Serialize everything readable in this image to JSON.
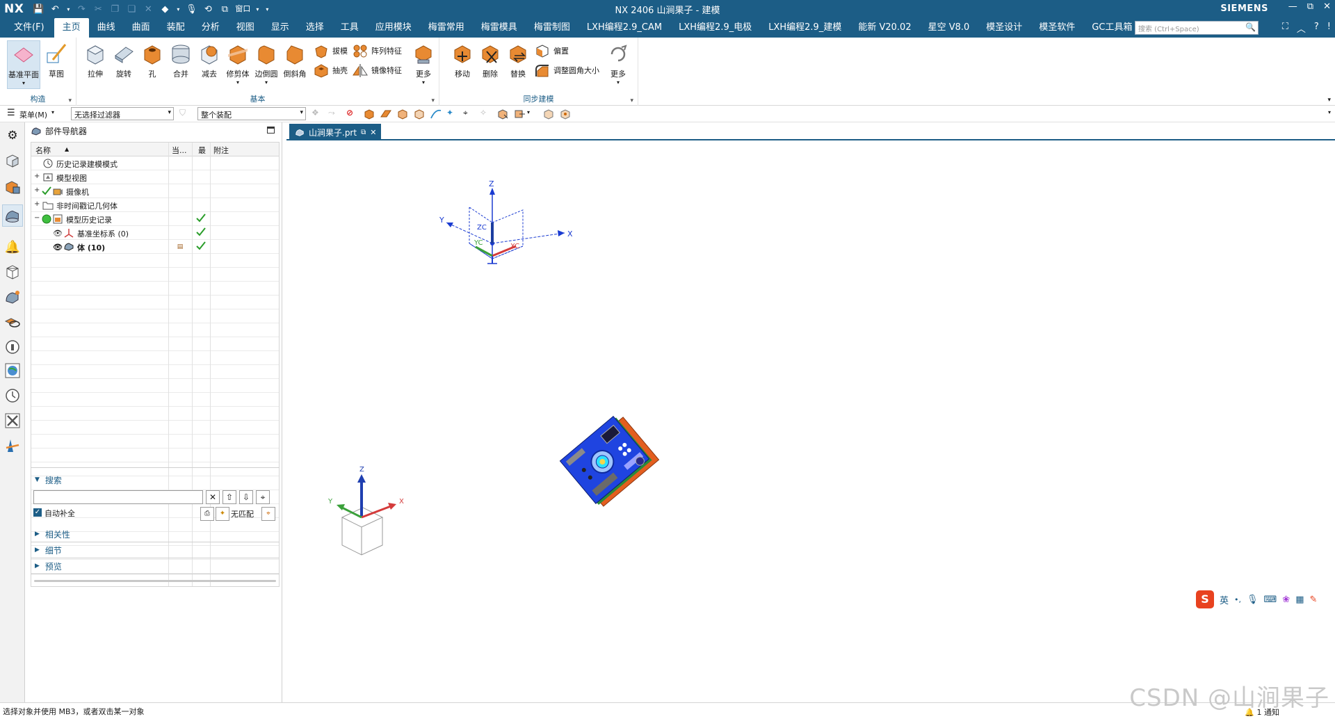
{
  "titlebar": {
    "logo": "NX",
    "title": "NX 2406 山涧果子 - 建模",
    "brand": "SIEMENS",
    "window_menu": "窗口",
    "win_min": "—",
    "win_restore": "⧉",
    "win_close": "✕"
  },
  "menubar": {
    "file": "文件(F)",
    "items": [
      "主页",
      "曲线",
      "曲面",
      "装配",
      "分析",
      "视图",
      "显示",
      "选择",
      "工具",
      "应用模块",
      "梅雷常用",
      "梅雷模具",
      "梅雷制图",
      "LXH编程2.9_CAM",
      "LXH编程2.9_电极",
      "LXH编程2.9_建模",
      "能新 V20.02",
      "星空 V8.0",
      "模圣设计",
      "模圣软件",
      "GC工具箱"
    ],
    "active": "主页",
    "search_placeholder": "搜索 (Ctrl+Space)"
  },
  "ribbon": {
    "groups": {
      "construct": "构造",
      "basic": "基本",
      "sync": "同步建模"
    },
    "construct_buttons": {
      "datum_plane": "基准平面",
      "sketch": "草图"
    },
    "basic_buttons": {
      "extrude": "拉伸",
      "revolve": "旋转",
      "hole": "孔",
      "unite": "合并",
      "subtract": "减去",
      "trim_body": "修剪体",
      "edge_blend": "边倒圆",
      "chamfer": "倒斜角",
      "draft": "拔模",
      "shell": "抽壳",
      "pattern_feature": "阵列特征",
      "mirror_feature": "镜像特征",
      "more": "更多"
    },
    "sync_buttons": {
      "move": "移动",
      "delete": "删除",
      "replace": "替换",
      "offset": "偏置",
      "resize_blend": "调整圆角大小",
      "more": "更多"
    }
  },
  "selection_bar": {
    "menu": "菜单(M)",
    "filter": "无选择过滤器",
    "scope": "整个装配"
  },
  "navigator": {
    "title": "部件导航器",
    "columns": {
      "name": "名称",
      "current": "当...",
      "latest": "最",
      "note": "附注"
    },
    "rows": [
      {
        "label": "历史记录建模模式",
        "icon": "clock-icon"
      },
      {
        "label": "模型视图",
        "icon": "model-views-icon"
      },
      {
        "label": "摄像机",
        "icon": "camera-icon"
      },
      {
        "label": "非时间戳记几何体",
        "icon": "folder-icon"
      },
      {
        "label": "模型历史记录",
        "icon": "history-icon"
      },
      {
        "label": "基准坐标系 (0)",
        "icon": "datum-csys-icon"
      },
      {
        "label": "体 (10)",
        "icon": "body-icon"
      }
    ]
  },
  "search_panel": {
    "title": "搜索",
    "autocomplete": "自动补全",
    "no_match": "无匹配",
    "sections": [
      "相关性",
      "细节",
      "预览"
    ]
  },
  "tab": {
    "label": "山涧果子.prt"
  },
  "viewport": {
    "csys_labels": {
      "z": "Z",
      "y": "Y",
      "x": "X",
      "zc": "ZC",
      "yc": "YC",
      "xc": "XC"
    },
    "triad_labels": {
      "z": "Z",
      "y": "Y",
      "x": "X"
    },
    "ime_label": "英"
  },
  "status": {
    "prompt": "选择对象并使用 MB3，或者双击某一对象",
    "notification": "1 通知"
  },
  "watermark": "CSDN @山涧果子",
  "colors": {
    "accent": "#1c5d86",
    "check": "#2a9d2a"
  }
}
